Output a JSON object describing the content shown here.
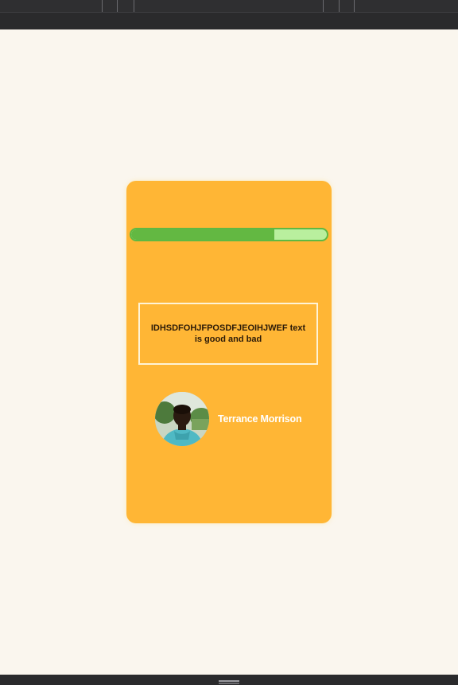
{
  "card": {
    "progress_fraction": 0.73,
    "text": "IDHSDFOHJFPOSDFJEOIHJWEF text is good and bad",
    "profile": {
      "name": "Terrance Morrison",
      "avatar_icon": "person-photo"
    }
  },
  "colors": {
    "card_bg": "#ffb635",
    "page_bg": "#faf6ee",
    "progress_fill": "#63b842",
    "progress_track": "#b9ef9e",
    "name_text": "#ffffff",
    "body_text": "#2b1a08"
  }
}
